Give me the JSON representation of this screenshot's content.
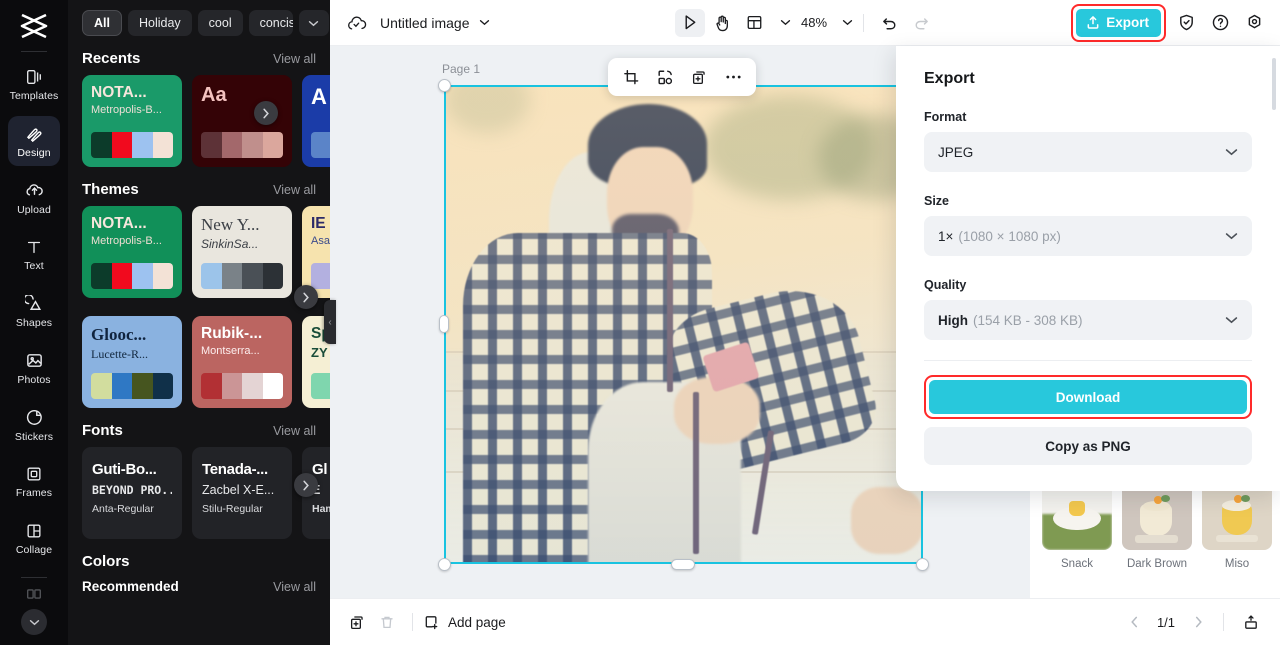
{
  "brand": {
    "accent": "#28c8dc",
    "highlight": "#ff2a2a",
    "selection": "#19c3e0"
  },
  "rail": {
    "items": [
      {
        "label": "Templates",
        "icon": "templates-icon",
        "active": false
      },
      {
        "label": "Design",
        "icon": "design-icon",
        "active": true
      },
      {
        "label": "Upload",
        "icon": "upload-icon",
        "active": false
      },
      {
        "label": "Text",
        "icon": "text-icon",
        "active": false
      },
      {
        "label": "Shapes",
        "icon": "shapes-icon",
        "active": false
      },
      {
        "label": "Photos",
        "icon": "photos-icon",
        "active": false
      },
      {
        "label": "Stickers",
        "icon": "stickers-icon",
        "active": false
      },
      {
        "label": "Frames",
        "icon": "frames-icon",
        "active": false
      },
      {
        "label": "Collage",
        "icon": "collage-icon",
        "active": false
      }
    ]
  },
  "panel": {
    "chips": [
      {
        "label": "All",
        "selected": true
      },
      {
        "label": "Holiday",
        "selected": false
      },
      {
        "label": "cool",
        "selected": false
      },
      {
        "label": "concise",
        "selected": false
      }
    ],
    "view_all": "View all",
    "sections": {
      "recents": {
        "title": "Recents",
        "cards": [
          {
            "t1": "NOTA...",
            "t2": "Metropolis-B...",
            "bg": "#1a9a69",
            "fg": "#f6e6dc",
            "fg2": "#eddfd6",
            "swatches": [
              "#0c3b2a",
              "#f10a1e",
              "#9dc2f0",
              "#f3e2d6"
            ]
          },
          {
            "t1": "Aa",
            "t2": "",
            "bg": "#340306",
            "fg": "#f4c2bf",
            "fg2": "#f4c2bf",
            "swatches": [
              "#5d3237",
              "#a3686b",
              "#c08f8c",
              "#dba79d"
            ]
          },
          {
            "t1": "A",
            "t2": "",
            "bg": "#1b3ca8",
            "fg": "#ffffff",
            "fg2": "#ffffff",
            "swatches": [
              "#5b84c8",
              "#5b84c8",
              "#5b84c8",
              "#5b84c8"
            ]
          }
        ]
      },
      "themes": {
        "title": "Themes",
        "cards": [
          {
            "t1": "NOTA...",
            "t2": "Metropolis-B...",
            "bg": "#119059",
            "fg": "#f7e7dd",
            "fg2": "#f0ded3",
            "swatches": [
              "#0c3b2a",
              "#f10a1e",
              "#9dc2f0",
              "#f3e2d6"
            ]
          },
          {
            "t1": "New Y...",
            "t2": "SinkinSa...",
            "bg": "#e9e6de",
            "fg": "#3b3f45",
            "fg2": "#3b3f45",
            "swatches": [
              "#9cc4ea",
              "#7a8288",
              "#4a5056",
              "#2c3136"
            ]
          },
          {
            "t1": "IE",
            "t2": "Asa",
            "bg": "#f6e3ae",
            "fg": "#2c2a68",
            "fg2": "#3a4a8c",
            "swatches": [
              "#b3b0e0",
              "#b3b0e0",
              "#b3b0e0",
              "#b3b0e0"
            ]
          },
          {
            "t1": "Glooc...",
            "t2": "Lucette-R...",
            "bg": "#8ab2e0",
            "fg": "#10243f",
            "fg2": "#12283f",
            "swatches": [
              "#d2dd9e",
              "#2f78c4",
              "#46551f",
              "#103049"
            ]
          },
          {
            "t1": "Rubik-...",
            "t2": "Montserra...",
            "bg": "#bb6561",
            "fg": "#ffffff",
            "fg2": "#fdeeee",
            "swatches": [
              "#b23034",
              "#cb9596",
              "#e4d4d4",
              "#ffffff"
            ]
          },
          {
            "t1": "Sp",
            "t2": "ZY",
            "bg": "#f5efd4",
            "fg": "#1a4d39",
            "fg2": "#1a4d39",
            "swatches": [
              "#7fd6ae",
              "#7fd6ae",
              "#7fd6ae",
              "#7fd6ae"
            ]
          }
        ]
      },
      "fonts": {
        "title": "Fonts",
        "cards": [
          {
            "f1": "Guti-Bo...",
            "f2": "BEYOND PRO...",
            "f3": "Anta-Regular"
          },
          {
            "f1": "Tenada-...",
            "f2": "Zacbel X-E...",
            "f3": "Stilu-Regular"
          },
          {
            "f1": "Gl",
            "f2": "E",
            "f3": "Ham"
          }
        ]
      },
      "colors": {
        "title": "Colors",
        "sub": "Recommended"
      }
    }
  },
  "topbar": {
    "cloud_icon": "cloud-check-icon",
    "doc_title": "Untitled image",
    "title_caret": "chevron-down-icon",
    "tools": [
      {
        "name": "select-tool",
        "icon": "cursor-icon",
        "active": true
      },
      {
        "name": "hand-tool",
        "icon": "hand-icon",
        "active": false
      },
      {
        "name": "layout-tool",
        "icon": "layout-icon",
        "active": false
      }
    ],
    "zoom": "48%",
    "undo_icon": "undo-icon",
    "redo_icon": "redo-icon",
    "export_label": "Export",
    "export_icon": "export-upload-icon",
    "right_icons": [
      "shield-check-icon",
      "help-circle-icon",
      "gear-icon"
    ]
  },
  "canvas": {
    "page_label": "Page 1",
    "float_toolbar": [
      "crop-icon",
      "remove-background-icon",
      "duplicate-icon",
      "more-horizontal-icon"
    ],
    "top_right_icon": "layers-icon"
  },
  "thumbs": [
    {
      "label": "Snack"
    },
    {
      "label": "Dark Brown"
    },
    {
      "label": "Miso"
    }
  ],
  "export": {
    "title": "Export",
    "format_label": "Format",
    "format_value": "JPEG",
    "size_label": "Size",
    "size_value": "1×",
    "size_detail": "(1080 × 1080 px)",
    "quality_label": "Quality",
    "quality_value": "High",
    "quality_detail": "(154 KB - 308 KB)",
    "download_label": "Download",
    "copy_label": "Copy as PNG",
    "caret_icon": "chevron-down-icon"
  },
  "bottombar": {
    "duplicate_page_icon": "duplicate-page-icon",
    "delete_page_icon": "trash-icon",
    "add_page_label": "Add page",
    "add_page_icon": "add-page-icon",
    "page_indicator": "1/1",
    "prev_icon": "chevron-left-icon",
    "next_icon": "chevron-right-icon",
    "present_icon": "present-icon"
  }
}
